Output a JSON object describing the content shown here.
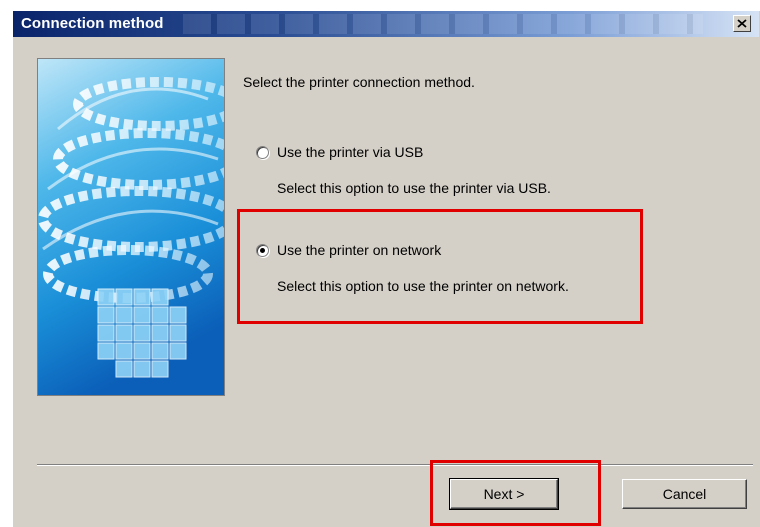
{
  "window": {
    "title": "Connection method",
    "close_glyph": "×"
  },
  "main": {
    "heading": "Select the printer connection method.",
    "options": [
      {
        "label": "Use the printer via USB",
        "description": "Select this option to use the printer via USB.",
        "selected": false
      },
      {
        "label": "Use the printer on network",
        "description": "Select this option to use the printer on network.",
        "selected": true
      }
    ]
  },
  "footer": {
    "next_label": "Next >",
    "cancel_label": "Cancel"
  },
  "colors": {
    "dialog_bg": "#d4d0c8",
    "titlebar_dark": "#0a246a",
    "highlight_red": "#e00000"
  },
  "icons": {
    "close": "close-icon",
    "radio_unchecked": "radio-unchecked-icon",
    "radio_checked": "radio-checked-icon",
    "art": "printer-setup-illustration"
  }
}
